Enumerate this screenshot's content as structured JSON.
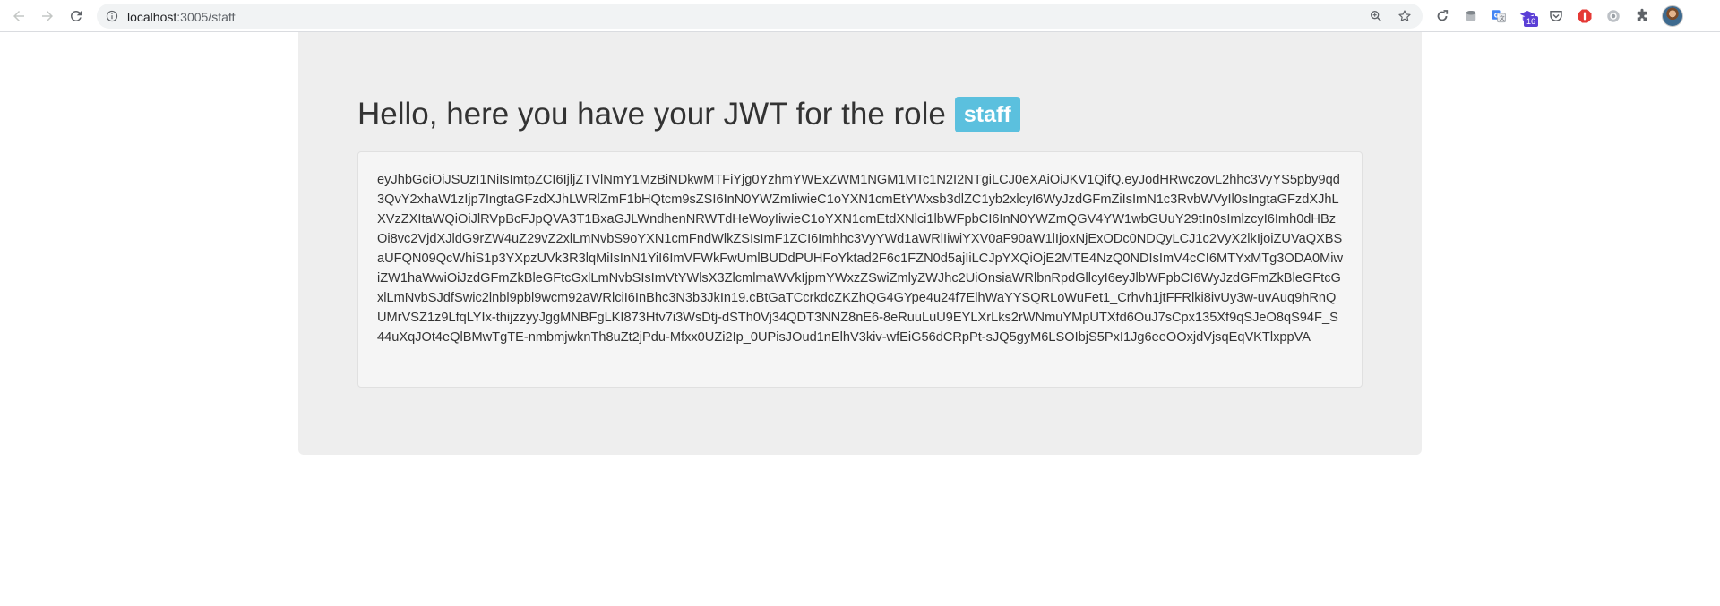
{
  "browser": {
    "url_host": "localhost",
    "url_rest": ":3005/staff",
    "extension_badge": "16",
    "colors": {
      "chrome_bg": "#ffffff",
      "omnibox_bg": "#f1f3f4",
      "icon_gray": "#5f6368",
      "badge_purple": "#5b3fd6"
    }
  },
  "page": {
    "heading": "Hello, here you have your JWT for the role",
    "role": "staff",
    "token": "eyJhbGciOiJSUzI1NiIsImtpZCI6IjljZTVlNmY1MzBiNDkwMTFiYjg0YzhmYWExZWM1NGM1MTc1N2I2NTgiLCJ0eXAiOiJKV1QifQ.eyJodHRwczovL2hhc3VyYS5pby9qd3QvY2xhaW1zIjp7IngtaGFzdXJhLWRlZmF1bHQtcm9sZSI6InN0YWZmIiwieC1oYXN1cmEtYWxsb3dlZC1yb2xlcyI6WyJzdGFmZiIsImN1c3RvbWVyIl0sIngtaGFzdXJhLXVzZXItaWQiOiJlRVpBcFJpQVA3T1BxaGJLWndhenNRWTdHeWoyIiwieC1oYXN1cmEtdXNlci1lbWFpbCI6InN0YWZmQGV4YW1wbGUuY29tIn0sImlzcyI6Imh0dHBzOi8vc2VjdXJldG9rZW4uZ29vZ2xlLmNvbS9oYXN1cmFndWlkZSIsImF1ZCI6Imhhc3VyYWd1aWRlIiwiYXV0aF90aW1lIjoxNjExODc0NDQyLCJ1c2VyX2lkIjoiZUVaQXBSaUFQN09QcWhiS1p3YXpzUVk3R3lqMiIsInN1YiI6ImVFWkFwUmlBUDdPUHFoYktad2F6c1FZN0d5ajIiLCJpYXQiOjE2MTE4NzQ0NDIsImV4cCI6MTYxMTg3ODA0MiwiZW1haWwiOiJzdGFmZkBleGFtcGxlLmNvbSIsImVtYWlsX3ZlcmlmaWVkIjpmYWxzZSwiZmlyZWJhc2UiOnsiaWRlbnRpdGllcyI6eyJlbWFpbCI6WyJzdGFmZkBleGFtcGxlLmNvbSJdfSwic2lnbl9pbl9wcm92aWRlciI6InBhc3N3b3JkIn19.cBtGaTCcrkdcZKZhQG4GYpe4u24f7ElhWaYYSQRLoWuFet1_Crhvh1jtFFRlki8ivUy3w-uvAuq9hRnQUMrVSZ1z9LfqLYIx-thijzzyyJggMNBFgLKI873Htv7i3WsDtj-dSTh0Vj34QDT3NNZ8nE6-8eRuuLuU9EYLXrLks2rWNmuYMpUTXfd6OuJ7sCpx135Xf9qSJeO8qS94F_S44uXqJOt4eQlBMwTgTE-nmbmjwknTh8uZt2jPdu-Mfxx0UZi2Ip_0UPisJOud1nElhV3kiv-wfEiG56dCRpPt-sJQ5gyM6LSOIbjS5PxI1Jg6eeOOxjdVjsqEqVKTlxppVA",
    "colors": {
      "panel_bg": "#eeeeee",
      "well_bg": "#f5f5f5",
      "text": "#333333",
      "role_badge_bg": "#5bc0de"
    }
  }
}
